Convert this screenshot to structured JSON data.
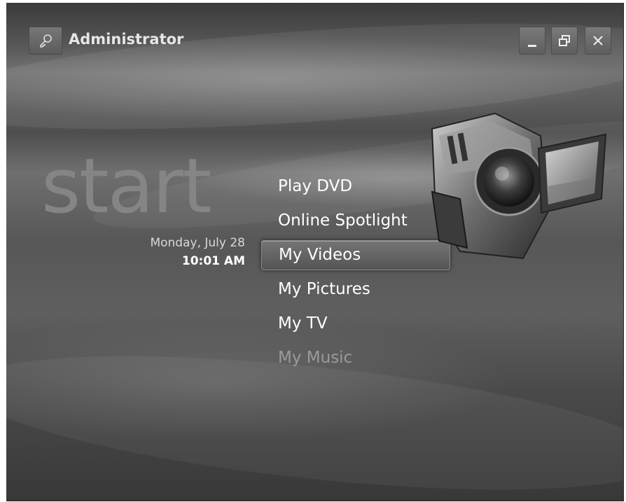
{
  "user": {
    "name": "Administrator",
    "icon": "key-icon"
  },
  "window_controls": {
    "minimize": "minimize-icon",
    "restore": "restore-icon",
    "close": "close-icon"
  },
  "start": {
    "label": "start",
    "date": "Monday, July 28",
    "time": "10:01 AM"
  },
  "menu": {
    "items": [
      {
        "label": "Play DVD"
      },
      {
        "label": "Online Spotlight"
      },
      {
        "label": "My Videos",
        "selected": true
      },
      {
        "label": "My Pictures"
      },
      {
        "label": "My TV"
      },
      {
        "label": "My Music",
        "dimmed": true
      }
    ]
  },
  "graphic": {
    "icon": "camcorder-icon"
  }
}
